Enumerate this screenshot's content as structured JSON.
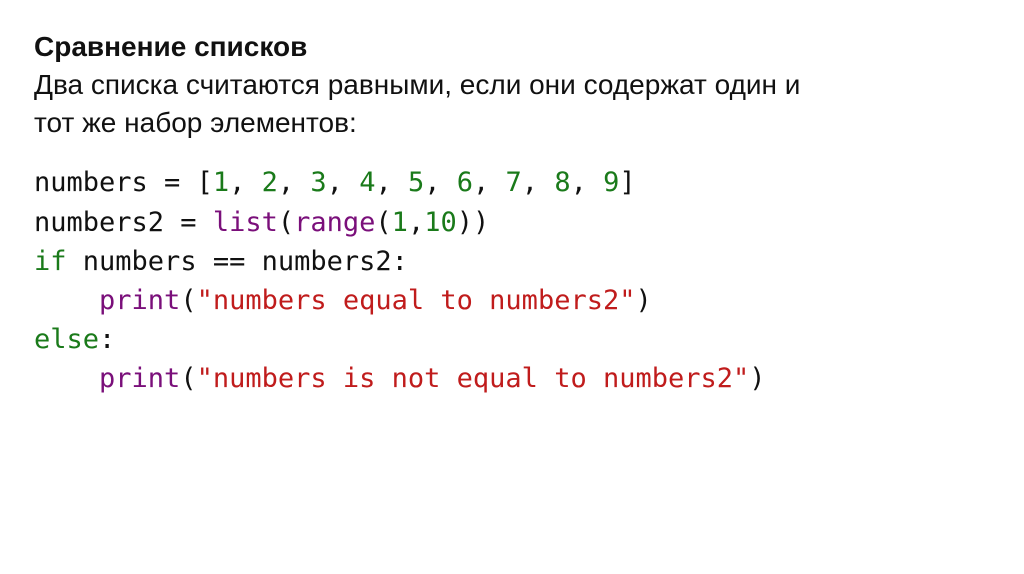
{
  "heading": {
    "title": "Сравнение списков",
    "desc_line1": "Два списка считаются равными, если они содержат один и",
    "desc_line2": "тот же набор элементов:"
  },
  "code": {
    "l1": {
      "lhs": "numbers",
      "eq": " = ",
      "lb": "[",
      "n1": "1",
      "c": ", ",
      "n2": "2",
      "n3": "3",
      "n4": "4",
      "n5": "5",
      "n6": "6",
      "n7": "7",
      "n8": "8",
      "n9": "9",
      "rb": "]"
    },
    "l2": {
      "lhs": "numbers2",
      "eq": " = ",
      "fn_list": "list",
      "lp": "(",
      "fn_range": "range",
      "lp2": "(",
      "a1": "1",
      "comma": ",",
      "a2": "10",
      "rp2": ")",
      "rp": ")"
    },
    "l3": {
      "kw_if": "if",
      "sp": " ",
      "lhs": "numbers",
      "op": " == ",
      "rhs": "numbers2",
      "colon": ":"
    },
    "l4": {
      "indent": "    ",
      "fn_print": "print",
      "lp": "(",
      "str": "\"numbers equal to numbers2\"",
      "rp": ")"
    },
    "l5": {
      "kw_else": "else",
      "colon": ":"
    },
    "l6": {
      "indent": "    ",
      "fn_print": "print",
      "lp": "(",
      "str": "\"numbers is not equal to numbers2\"",
      "rp": ")"
    }
  }
}
